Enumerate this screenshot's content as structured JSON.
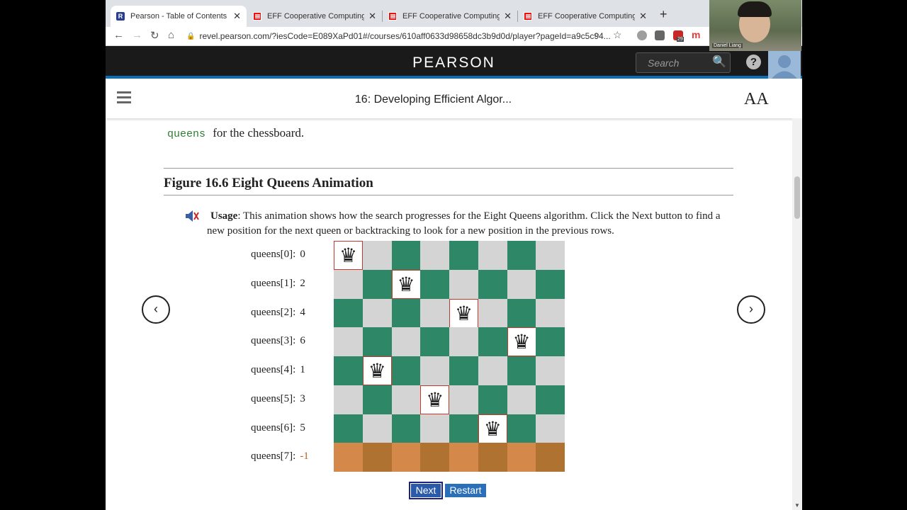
{
  "browser": {
    "tabs": [
      {
        "title": "Pearson - Table of Contents",
        "favicon": "R"
      },
      {
        "title": "EFF Cooperative Computing Aw",
        "favicon": "E"
      },
      {
        "title": "EFF Cooperative Computing Aw",
        "favicon": "E"
      },
      {
        "title": "EFF Cooperative Computing Aw",
        "favicon": "E"
      }
    ],
    "close_glyph": "✕",
    "new_tab_glyph": "+",
    "url": "revel.pearson.com/?iesCode=E089XaPd01#/courses/610aff0633d98658dc3b9d0d/player?pageId=a9c5c94...",
    "ext_badge": "29"
  },
  "header": {
    "logo": "PEARSON",
    "search_placeholder": "Search",
    "help_glyph": "?"
  },
  "chapter": {
    "title": "16: Developing Efficient Algor...",
    "font_glyph": "AA"
  },
  "content": {
    "intro_code": "queens",
    "intro_text": "for the chessboard.",
    "figure_title": "Figure 16.6 Eight Queens Animation",
    "usage_label": "Usage",
    "usage_text": ": This animation shows how the search progresses for the Eight Queens algorithm. Click the Next button to find a new position for the next queen or backtracking to look for a new position in the previous rows."
  },
  "nav": {
    "prev": "‹",
    "next": "›"
  },
  "queens": [
    {
      "label": "queens[0]:",
      "value": "0"
    },
    {
      "label": "queens[1]:",
      "value": "2"
    },
    {
      "label": "queens[2]:",
      "value": "4"
    },
    {
      "label": "queens[3]:",
      "value": "6"
    },
    {
      "label": "queens[4]:",
      "value": "1"
    },
    {
      "label": "queens[5]:",
      "value": "3"
    },
    {
      "label": "queens[6]:",
      "value": "5"
    },
    {
      "label": "queens[7]:",
      "value": "-1"
    }
  ],
  "board": {
    "size": 8,
    "queen_columns": [
      0,
      2,
      4,
      6,
      1,
      3,
      5,
      -1
    ],
    "current_row": 7,
    "queen_glyph": "♛",
    "colors": {
      "light": "#d4d4d4",
      "dark": "#2e8868",
      "current_a": "#d4884a",
      "current_b": "#b07230"
    }
  },
  "buttons": {
    "next": "Next",
    "restart": "Restart"
  },
  "webcam": {
    "name": "Daniel Liang"
  }
}
